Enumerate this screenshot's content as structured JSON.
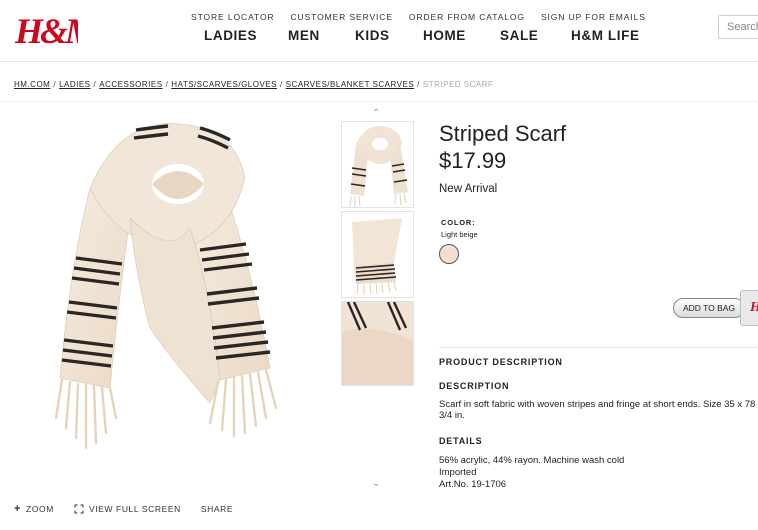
{
  "header": {
    "logo_text": "H&M",
    "top_links": [
      "STORE LOCATOR",
      "CUSTOMER SERVICE",
      "ORDER FROM CATALOG",
      "SIGN UP FOR EMAILS"
    ],
    "nav": [
      "LADIES",
      "MEN",
      "KIDS",
      "HOME",
      "SALE",
      "H&M LIFE"
    ],
    "search_placeholder": "Search"
  },
  "breadcrumb": {
    "items": [
      "HM.COM",
      "LADIES",
      "ACCESSORIES",
      "HATS/SCARVES/GLOVES",
      "SCARVES/BLANKET SCARVES"
    ],
    "current": "STRIPED SCARF"
  },
  "product": {
    "title": "Striped Scarf",
    "price": "$17.99",
    "badge": "New Arrival",
    "color_label": "COLOR:",
    "color_value": "Light beige",
    "swatch_color": "#f2dfd3",
    "add_to_bag": "ADD TO BAG",
    "description_heading": "PRODUCT DESCRIPTION",
    "description_title": "DESCRIPTION",
    "description_text": "Scarf in soft fabric with woven stripes and fringe at short ends. Size 35 x 78 3/4 in.",
    "details_title": "DETAILS",
    "details_lines": [
      "56% acrylic, 44% rayon. Machine wash cold",
      "Imported",
      "Art.No. 19-1706"
    ]
  },
  "tools": {
    "zoom": "ZOOM",
    "fullscreen": "VIEW FULL SCREEN",
    "share": "SHARE"
  },
  "colors": {
    "brand_red": "#cc071e",
    "scarf_base": "#f3e6d8",
    "stripe": "#2a2624"
  },
  "icons": [
    "chevron-up-icon",
    "chevron-down-icon",
    "plus-icon",
    "fullscreen-icon"
  ]
}
